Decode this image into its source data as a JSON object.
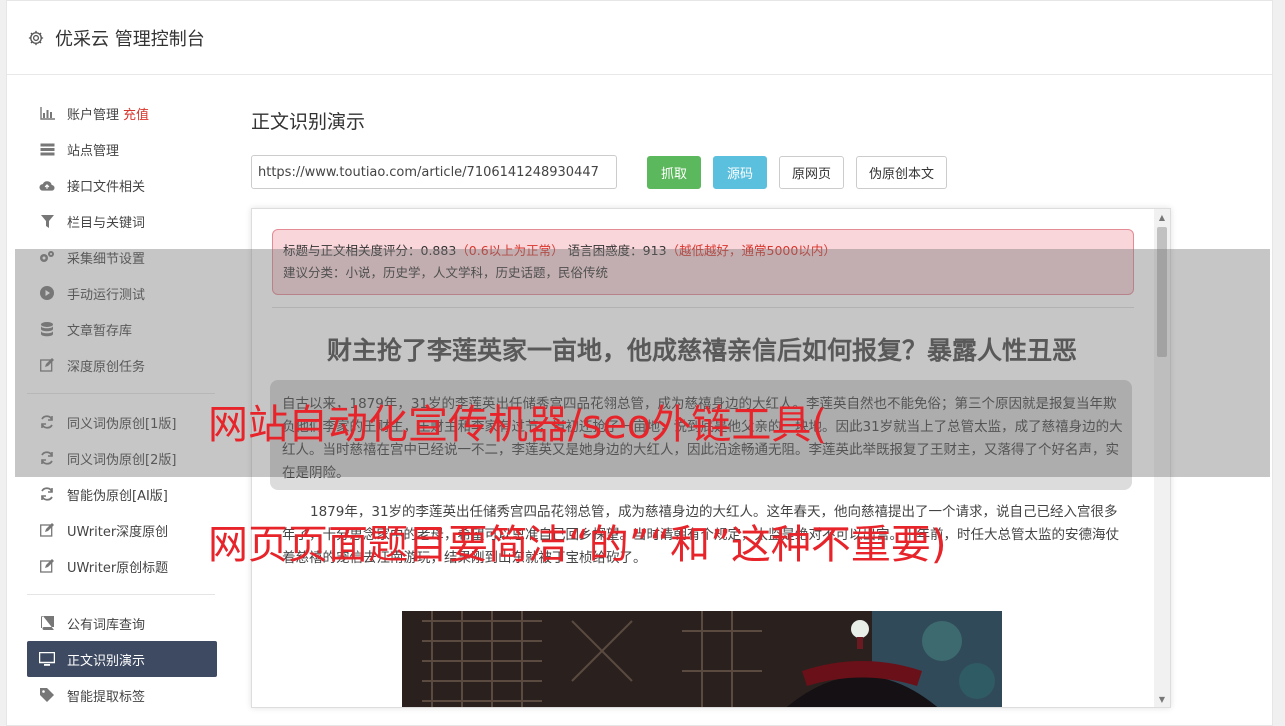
{
  "header": {
    "title": "优采云 管理控制台"
  },
  "sidebar": {
    "group1": [
      {
        "label": "账户管理",
        "badge": "充值",
        "icon": "bar-chart-icon"
      },
      {
        "label": "站点管理",
        "icon": "server-icon"
      },
      {
        "label": "接口文件相关",
        "icon": "cloud-upload-icon"
      },
      {
        "label": "栏目与关键词",
        "icon": "filter-icon"
      },
      {
        "label": "采集细节设置",
        "icon": "gears-icon"
      },
      {
        "label": "手动运行测试",
        "icon": "play-circle-icon"
      },
      {
        "label": "文章暂存库",
        "icon": "database-icon"
      },
      {
        "label": "深度原创任务",
        "icon": "edit-icon"
      }
    ],
    "group2": [
      {
        "label": "同义词伪原创[1版]",
        "icon": "refresh-icon"
      },
      {
        "label": "同义词伪原创[2版]",
        "icon": "refresh-icon"
      },
      {
        "label": "智能伪原创[AI版]",
        "icon": "refresh-icon"
      },
      {
        "label": "UWriter深度原创",
        "icon": "edit-icon"
      },
      {
        "label": "UWriter原创标题",
        "icon": "edit-icon"
      }
    ],
    "group3": [
      {
        "label": "公有词库查询",
        "icon": "book-icon"
      },
      {
        "label": "正文识别演示",
        "icon": "monitor-icon"
      },
      {
        "label": "智能提取标签",
        "icon": "tag-icon"
      }
    ]
  },
  "main": {
    "title": "正文识别演示",
    "url_value": "https://www.toutiao.com/article/7106141248930447",
    "buttons": {
      "fetch": "抓取",
      "source": "源码",
      "original": "原网页",
      "rewrite": "伪原创本文"
    }
  },
  "analysis": {
    "relevance_label": "标题与正文相关度评分：0.883",
    "relevance_note": "（0.6以上为正常）",
    "perplexity_label": "语言困惑度：913",
    "perplexity_note": "（越低越好，通常5000以内）",
    "category_line": "建议分类：小说，历史学，人文学科，历史话题，民俗传统"
  },
  "article": {
    "title": "财主抢了李莲英家一亩地，他成慈禧亲信后如何报复？暴露人性丑恶",
    "para1": "自古以来，1879年，31岁的李莲英出任储秀宫四品花翎总管，成为慈禧身边的大红人。李莲英自然也不能免俗；第三个原因就是报复当年欺负他们李家的王财主，王财主和李家有过节，当初还抢了一亩地，说到底是他父亲的一块地。因此31岁就当上了总管太监，成了慈禧身边的大红人。当时慈禧在宫中已经说一不二，李莲英又是她身边的大红人，因此沿途畅通无阻。李莲英此举既报复了王财主，又落得了个好名声，实在是阴险。",
    "para2": "1879年，31岁的李莲英出任储秀宫四品花翎总管，成为慈禧身边的大红人。这年春天，他向慈禧提出了一个请求，说自己已经入宫很多年了，十分思念家中的老母，希望可以恩准自己回乡探望。当时清朝有个规定，太监是绝对不可以出宫。十年前，时任大总管太监的安德海仗着慈禧的宠信去江南游玩，结果刚到山东就被丁宝桢给砍了。"
  },
  "watermark": {
    "line1": "网站自动化宣传机器/seo外链工具(",
    "line2": "网页页面题目要简洁“的”“和”这种不重要)"
  }
}
